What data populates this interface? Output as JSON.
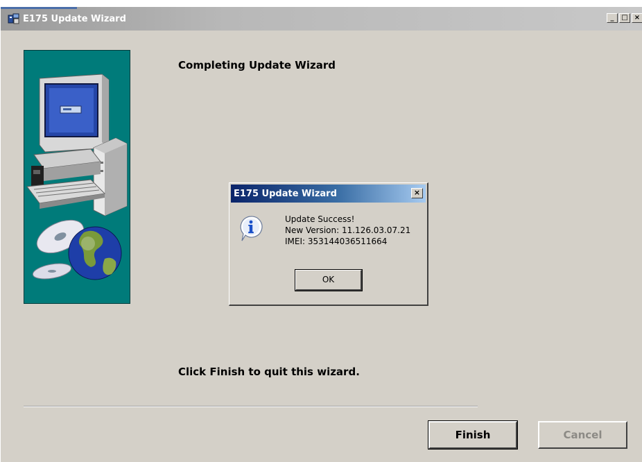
{
  "window": {
    "title": "E175 Update Wizard",
    "controls": {
      "minimize": "_",
      "maximize": "□",
      "close": "×"
    }
  },
  "wizard": {
    "heading": "Completing Update Wizard",
    "finish_message": "Click Finish to quit this wizard.",
    "finish_label": "Finish",
    "cancel_label": "Cancel",
    "cancel_enabled": false
  },
  "dialog": {
    "title": "E175 Update Wizard",
    "close": "×",
    "icon": "info-icon",
    "lines": [
      "Update Success!",
      "New Version: 11.126.03.07.21",
      "IMEI: 353144036511664"
    ],
    "ok_label": "OK"
  },
  "colors": {
    "dialog_titlebar": "#0a246a",
    "side_panel": "#007b7a",
    "window_background": "#d4d0c8"
  }
}
